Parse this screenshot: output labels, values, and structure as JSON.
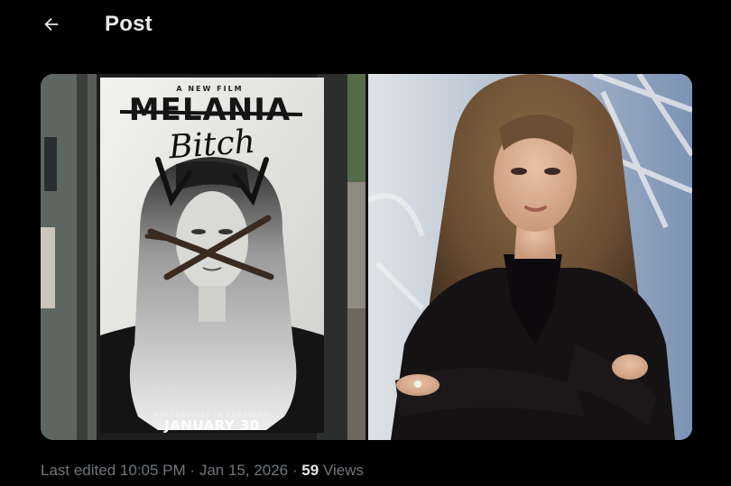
{
  "header": {
    "back_icon": "arrow-left-icon",
    "title": "Post"
  },
  "media": {
    "left_photo": {
      "film_label": "A NEW FILM",
      "film_title": "MELANIA",
      "graffiti_text": "Bitch",
      "tagline": "EXCLUSIVELY IN THEATERS",
      "release_date": "JANUARY 30"
    },
    "right_photo": {}
  },
  "meta": {
    "edited_label": "Last edited",
    "time": "10:05 PM",
    "separator": "·",
    "date": "Jan 15, 2026",
    "views_count": "59",
    "views_label": "Views"
  },
  "colors": {
    "background": "#000000",
    "primary_text": "#e7e9ea",
    "secondary_text": "#71767b"
  }
}
